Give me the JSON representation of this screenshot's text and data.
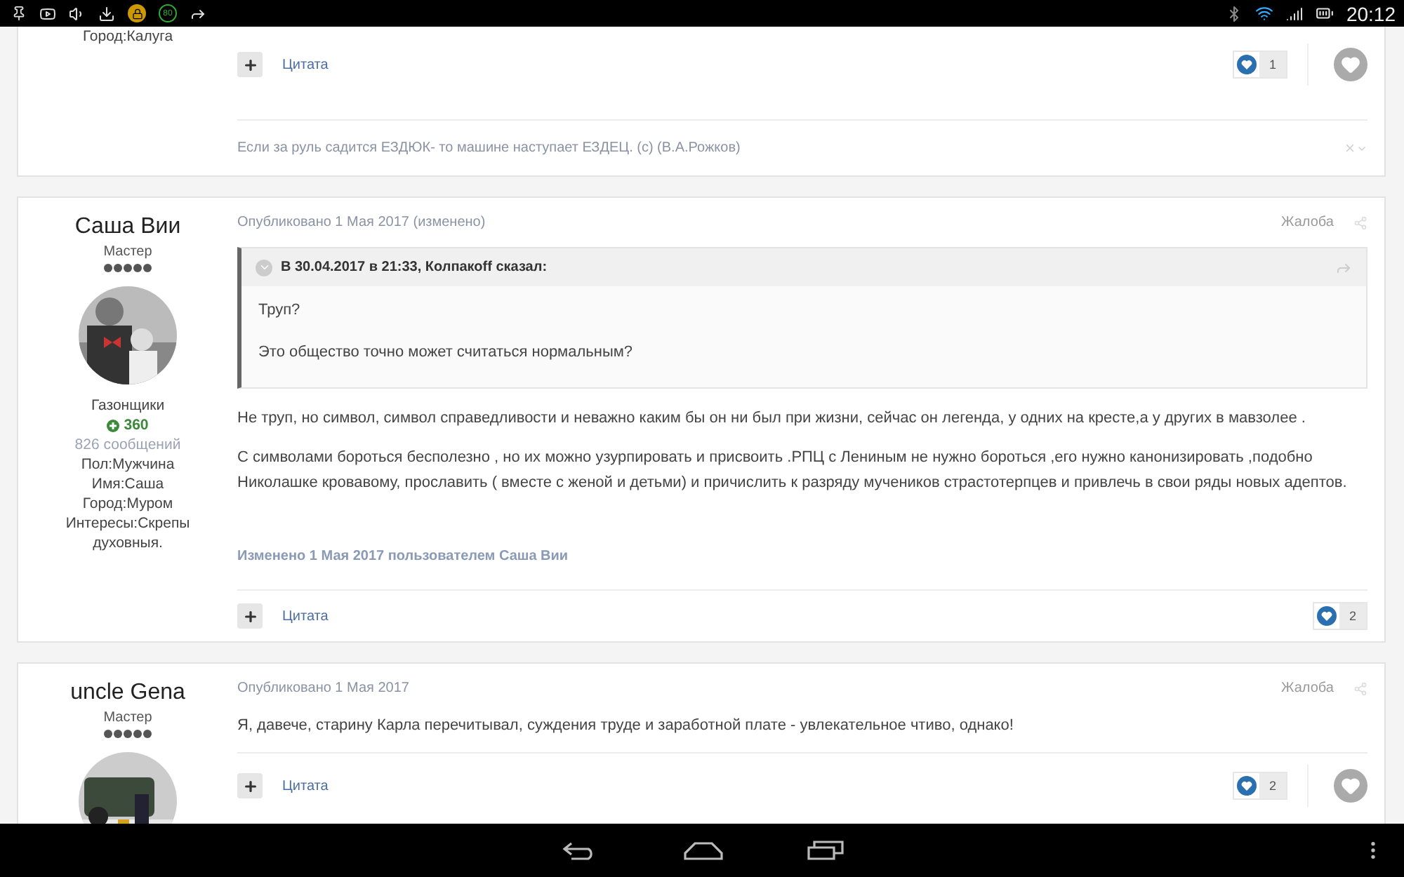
{
  "status_bar": {
    "badge": "80",
    "time": "20:12"
  },
  "posts": [
    {
      "author": {
        "profile_fields": [
          "Город:Калуга"
        ]
      },
      "quote_button": "Цитата",
      "reactions": "1",
      "like_button": true,
      "signature": "Если за руль садится ЕЗДЮК- то машине наступает ЕЗДЕЦ. (c) (В.А.Рожков)"
    },
    {
      "author": {
        "name": "Саша Вии",
        "rank": "Мастер",
        "stars": 5,
        "group": "Газонщики",
        "reputation": "360",
        "post_count": "826 сообщений",
        "profile_fields": [
          "Пол:Мужчина",
          "Имя:Саша",
          "Город:Муром",
          "Интересы:Скрепы духовныя."
        ]
      },
      "published": "Опубликовано 1 Мая 2017 (изменено)",
      "report": "Жалоба",
      "quote": {
        "header": "В 30.04.2017 в 21:33, Колпакоff сказал:",
        "lines": [
          "Труп?",
          "Это общество точно может считаться нормальным?"
        ]
      },
      "paragraphs": [
        "Не труп, но символ,  символ справедливости и неважно  каким бы он ни был при жизни, сейчас он легенда, у одних на кресте,а у других в мавзолее .",
        "С символами бороться бесполезно , но их можно узурпировать и присвоить .РПЦ с Лениным не нужно бороться ,его нужно канонизировать ,подобно Николашке кровавому, прославить ( вместе с женой и детьми) и причислить к разряду мучеников страстотерпцев и привлечь в свои ряды новых адептов."
      ],
      "edit_note": "Изменено 1 Мая 2017 пользователем Саша Вии",
      "quote_button": "Цитата",
      "reactions": "2",
      "like_button": false
    },
    {
      "author": {
        "name": "uncle Gena",
        "rank": "Мастер",
        "stars": 5
      },
      "published": "Опубликовано 1 Мая 2017",
      "report": "Жалоба",
      "paragraphs": [
        "Я, давече, старину Карла перечитывал, суждения труде и заработной плате - увлекательное чтиво, однако!"
      ],
      "quote_button": "Цитата",
      "reactions": "2",
      "like_button": true
    }
  ]
}
